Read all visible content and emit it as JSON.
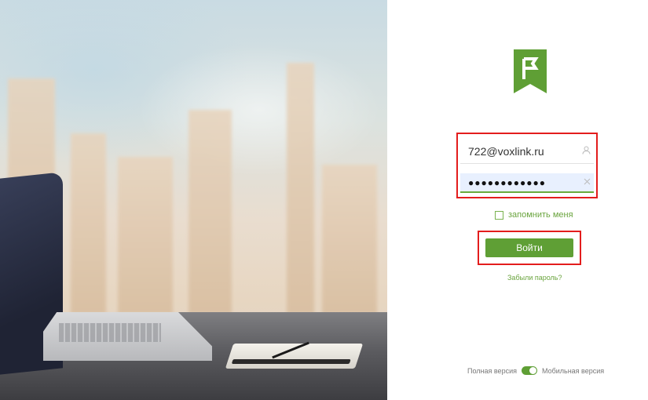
{
  "login": {
    "username_value": "722@voxlink.ru",
    "password_value": "●●●●●●●●●●●●",
    "remember_label": "запомнить меня",
    "submit_label": "Войти",
    "forgot_label": "Забыли пароль?"
  },
  "footer": {
    "full_version_label": "Полная версия",
    "mobile_version_label": "Мобильная версия"
  },
  "colors": {
    "brand_green": "#5f9f35",
    "highlight_red": "#e31d1d"
  },
  "icons": {
    "logo": "flag-logo-icon",
    "user_field": "user-icon",
    "password_field": "clear-icon"
  }
}
